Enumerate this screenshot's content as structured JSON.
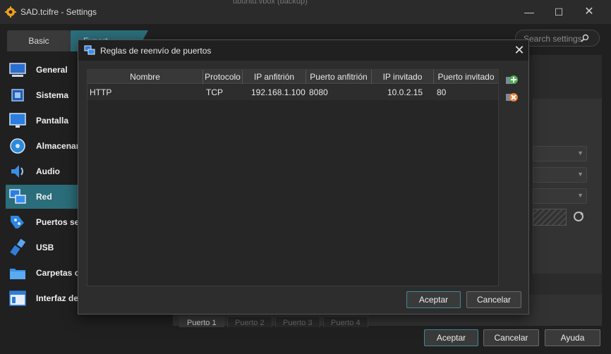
{
  "window": {
    "title": "SAD.tcifre - Settings",
    "background_fragment": "ubuntu.vbox (backup)",
    "minimize": "—",
    "maximize": "☐",
    "close": "✕"
  },
  "mode_tabs": {
    "basic": "Basic",
    "expert": "Expert"
  },
  "search": {
    "placeholder": "Search settings"
  },
  "sidebar": {
    "items": [
      {
        "label": "General",
        "icon": "general-icon"
      },
      {
        "label": "Sistema",
        "icon": "chip-icon"
      },
      {
        "label": "Pantalla",
        "icon": "monitor-icon"
      },
      {
        "label": "Almacenamiento",
        "icon": "disk-icon"
      },
      {
        "label": "Audio",
        "icon": "speaker-icon"
      },
      {
        "label": "Red",
        "icon": "network-icon"
      },
      {
        "label": "Puertos serie",
        "icon": "serial-port-icon"
      },
      {
        "label": "USB",
        "icon": "usb-icon"
      },
      {
        "label": "Carpetas compartidas",
        "icon": "folder-icon"
      },
      {
        "label": "Interfaz de usuario",
        "icon": "window-icon"
      }
    ]
  },
  "port_tabs": [
    "Puerto 1",
    "Puerto 2",
    "Puerto 3",
    "Puerto 4"
  ],
  "main_buttons": {
    "ok": "Aceptar",
    "cancel": "Cancelar",
    "help": "Ayuda"
  },
  "dialog": {
    "title": "Reglas de reenvío de puertos",
    "close": "✕",
    "columns": [
      "Nombre",
      "Protocolo",
      "IP anfitrión",
      "Puerto anfitrión",
      "IP invitado",
      "Puerto invitado"
    ],
    "rows": [
      {
        "name": "HTTP",
        "protocol": "TCP",
        "host_ip": "192.168.1.100",
        "host_port": "8080",
        "guest_ip": "10.0.2.15",
        "guest_port": "80"
      }
    ],
    "ok": "Aceptar",
    "cancel": "Cancelar"
  },
  "colors": {
    "accent": "#2b6d7a",
    "add_green": "#4caf50",
    "remove_orange": "#e8833a"
  }
}
